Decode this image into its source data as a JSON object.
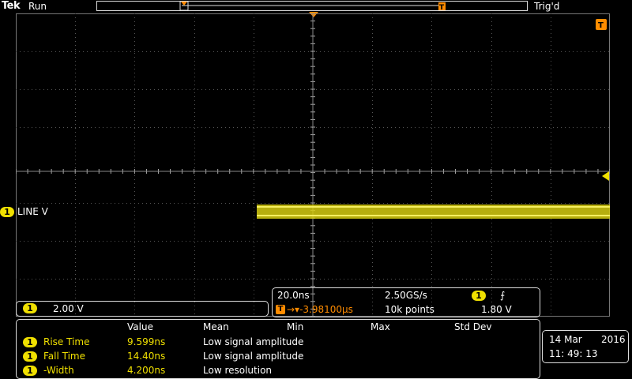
{
  "header": {
    "brand": "Tek",
    "run_state": "Run",
    "trigger_state": "Trig'd"
  },
  "channel": {
    "number": "1",
    "label": "LINE V",
    "scale": "2.00 V"
  },
  "timebase": {
    "time_per_div": "20.0ns",
    "sample_rate": "2.50GS/s",
    "record_length": "10k points",
    "trigger_position": "→▾-3.98100µs",
    "trigger_channel": "1",
    "trigger_slope": "⨍",
    "trigger_level": "1.80 V"
  },
  "measurements": {
    "headers": [
      "Value",
      "Mean",
      "Min",
      "Max",
      "Std Dev"
    ],
    "rows": [
      {
        "channel": "1",
        "name": "Rise Time",
        "value": "9.599ns",
        "mean": "Low signal amplitude"
      },
      {
        "channel": "1",
        "name": "Fall Time",
        "value": "14.40ns",
        "mean": "Low signal amplitude"
      },
      {
        "channel": "1",
        "name": "-Width",
        "value": "4.200ns",
        "mean": "Low resolution"
      }
    ]
  },
  "datetime": {
    "date_day": "14 Mar",
    "date_year": "2016",
    "time": "11: 49: 13"
  },
  "colors": {
    "channel1": "#f0e000",
    "trigger": "#ff8c00",
    "grid": "#888888"
  }
}
